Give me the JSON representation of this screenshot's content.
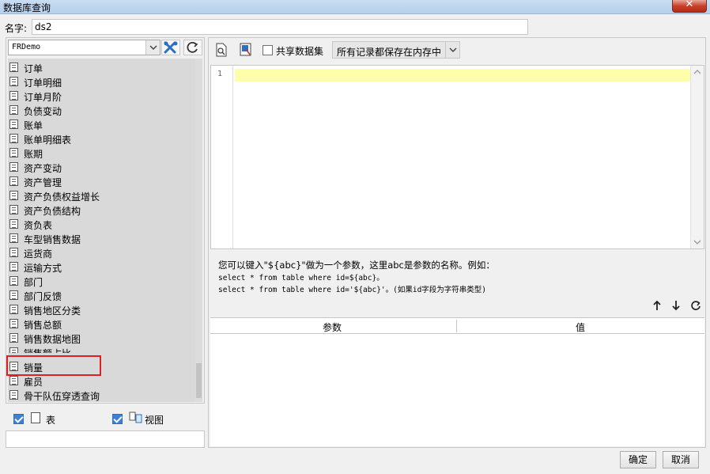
{
  "window": {
    "title": "数据库查询",
    "close_glyph": "✕"
  },
  "name_field": {
    "label": "名字:",
    "value": "ds2"
  },
  "left": {
    "database": "FRDemo",
    "tables": [
      "订单",
      "订单明细",
      "订单月阶",
      "负债变动",
      "账单",
      "账单明细表",
      "账期",
      "资产变动",
      "资产管理",
      "资产负债权益增长",
      "资产负债结构",
      "资负表",
      "车型销售数据",
      "运货商",
      "运输方式",
      "部门",
      "部门反馈",
      "销售地区分类",
      "销售总额",
      "销售数据地图",
      "销售额占比",
      "销量",
      "雇员",
      "骨干队伍穿透查询"
    ],
    "highlighted": "销量",
    "show_tables_label": "表",
    "show_views_label": "视图"
  },
  "right": {
    "share_dataset_label": "共享数据集",
    "storage_mode": "所有记录都保存在内存中",
    "line_number": "1",
    "hint_text": "您可以键入\"${abc}\"做为一个参数，这里abc是参数的名称。例如：",
    "code_line1": [
      "select ",
      "*",
      " from table where id=${abc}。"
    ],
    "code_line2": [
      "select ",
      "*",
      " from table where id='${abc}'。(如果id字段为字符串类型)"
    ],
    "param_table": {
      "col_param": "参数",
      "col_value": "值"
    }
  },
  "buttons": {
    "ok": "确定",
    "cancel": "取消"
  },
  "colors": {
    "accent": "#3b82d6",
    "highlight_border": "#e02020",
    "current_line": "#ffffaa"
  }
}
